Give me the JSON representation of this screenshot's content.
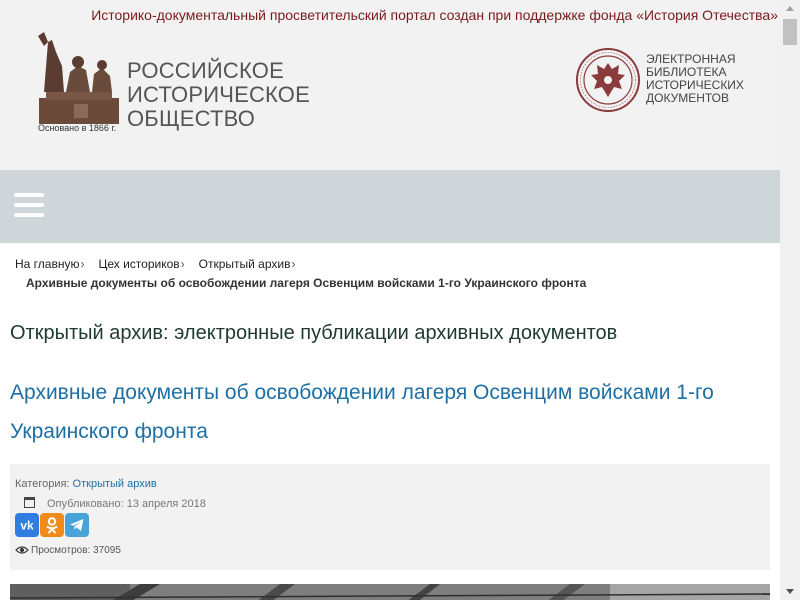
{
  "topbar": {
    "text": "Историко-документальный просветительский портал создан при поддержке фонда «История Отечества»"
  },
  "rio_logo": {
    "name_line1": "РОССИЙСКОЕ",
    "name_line2": "ИСТОРИЧЕСКОЕ",
    "name_line3": "ОБЩЕСТВО",
    "founded": "Основано в 1866 г."
  },
  "library_logo": {
    "line1": "ЭЛЕКТРОННАЯ",
    "line2": "БИБЛИОТЕКА",
    "line3": "ИСТОРИЧЕСКИХ",
    "line4": "ДОКУМЕНТОВ"
  },
  "breadcrumb": {
    "items": [
      {
        "label": "На главную"
      },
      {
        "label": "Цех историков"
      },
      {
        "label": "Открытый архив"
      }
    ],
    "separator": "›",
    "current": "Архивные документы об освобождении лагеря Освенцим войсками 1-го Украинского фронта"
  },
  "section_title": "Открытый архив: электронные публикации архивных документов",
  "article": {
    "title": "Архивные документы об освобождении лагеря Освенцим войсками 1-го Украинского фронта",
    "category_label": "Категория:",
    "category_value": "Открытый архив",
    "published": "Опубликовано: 13 апреля 2018",
    "views": "Просмотров: 37095"
  },
  "social": {
    "vk": "vk",
    "ok": "ok",
    "telegram": "telegram"
  },
  "icons": {
    "menu": "hamburger-menu-icon",
    "calendar": "calendar-icon",
    "views": "eye-icon"
  },
  "colors": {
    "topbar_text": "#7a1b1b",
    "nav_background": "#cfd6da",
    "article_title": "#1e6fa5",
    "vk": "#2f7de1",
    "ok": "#f08a1b",
    "telegram": "#4aa3d8"
  }
}
